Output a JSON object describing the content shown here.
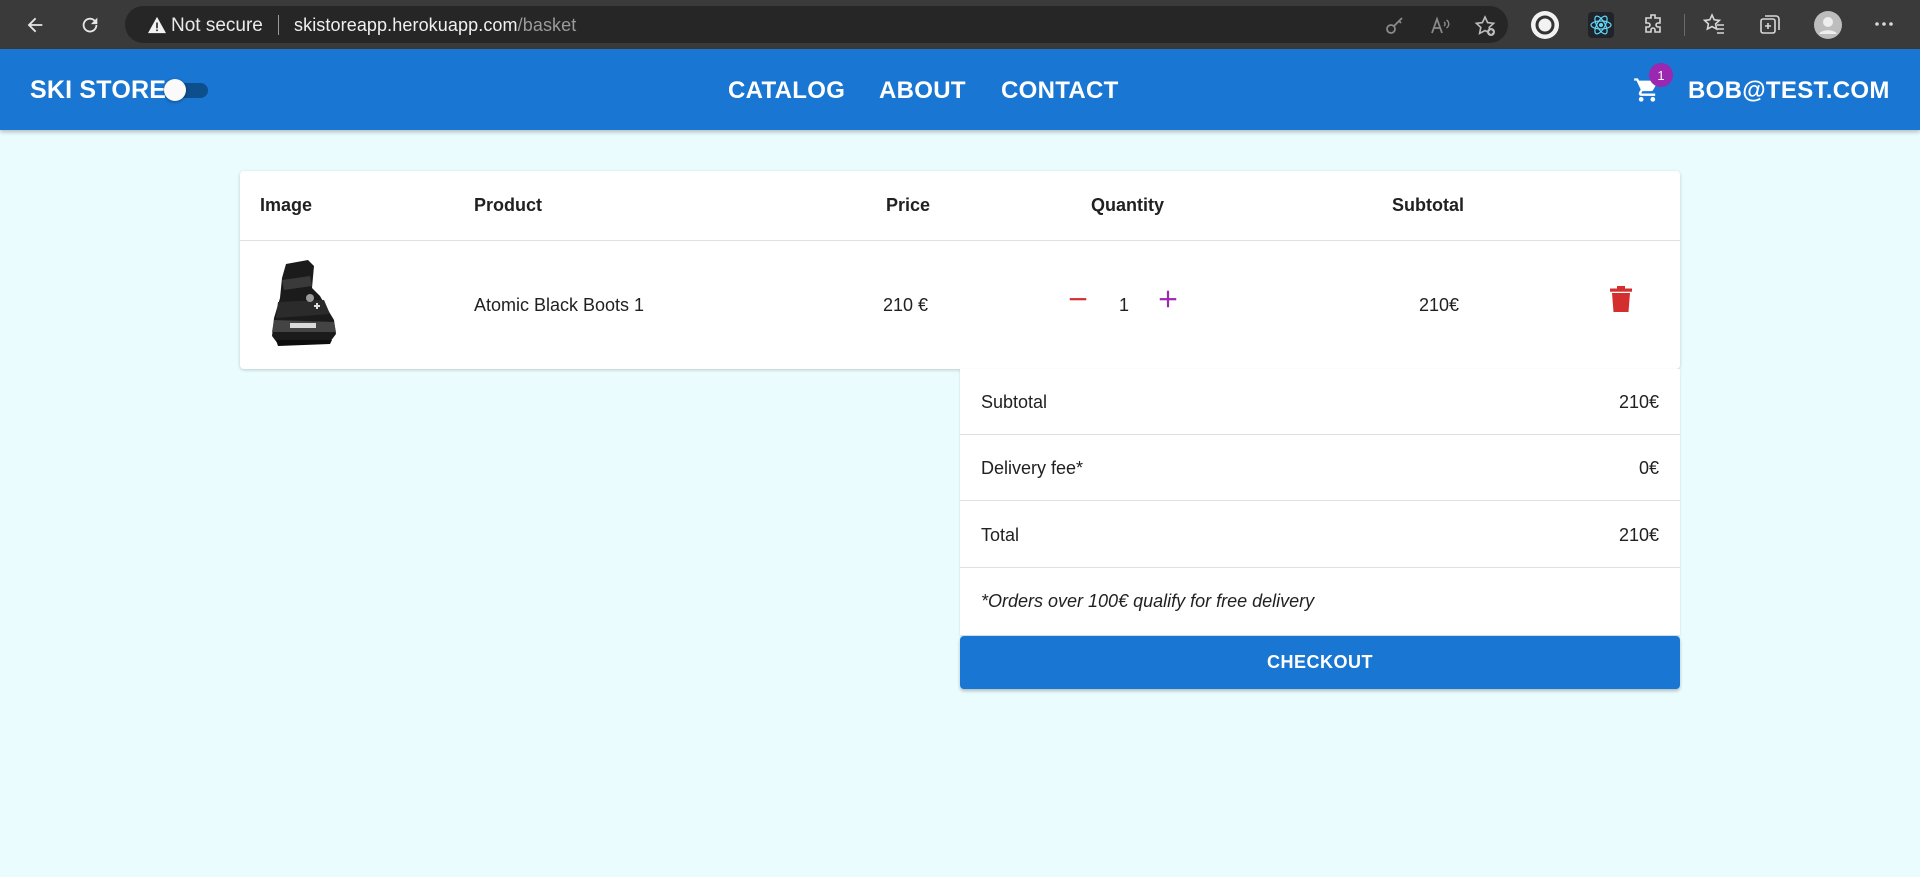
{
  "browser": {
    "security_label": "Not secure",
    "url_host": "skistoreapp.herokuapp.com",
    "url_path": "/basket"
  },
  "appbar": {
    "brand": "SKI STORE",
    "dark_mode_on": false,
    "nav": [
      "CATALOG",
      "ABOUT",
      "CONTACT"
    ],
    "cart_count": "1",
    "user": "BOB@TEST.COM",
    "colors": {
      "primary": "#1976d2",
      "badge": "#9c27b0"
    }
  },
  "basket": {
    "columns": {
      "image": "Image",
      "product": "Product",
      "price": "Price",
      "quantity": "Quantity",
      "subtotal": "Subtotal"
    },
    "items": [
      {
        "image": "boot-image",
        "product": "Atomic Black Boots 1",
        "price": "210 €",
        "quantity": "1",
        "subtotal": "210€"
      }
    ]
  },
  "summary": {
    "subtotal_label": "Subtotal",
    "subtotal_value": "210€",
    "delivery_label": "Delivery fee*",
    "delivery_value": "0€",
    "total_label": "Total",
    "total_value": "210€",
    "note": "*Orders over 100€ qualify for free delivery",
    "checkout_label": "CHECKOUT"
  }
}
